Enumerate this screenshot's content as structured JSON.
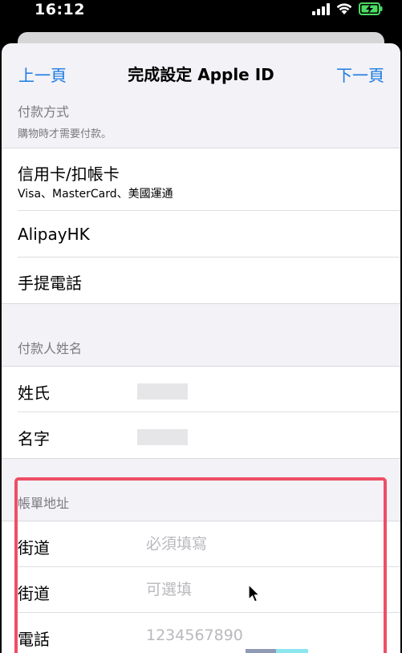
{
  "status_bar": {
    "time": "16:12",
    "icons": [
      "cellular-signal-icon",
      "wifi-icon",
      "battery-charging-icon"
    ],
    "battery_color": "#4cd964"
  },
  "nav": {
    "prev_label": "上一頁",
    "title": "完成設定 Apple ID",
    "next_label": "下一頁"
  },
  "payment": {
    "header": "付款方式",
    "subheader": "購物時才需要付款。",
    "options": [
      {
        "label": "信用卡/扣帳卡",
        "detail": "Visa、MasterCard、美國運通"
      },
      {
        "label": "AlipayHK"
      },
      {
        "label": "手提電話"
      }
    ]
  },
  "payer_name": {
    "header": "付款人姓名",
    "fields": [
      {
        "label": "姓氏"
      },
      {
        "label": "名字"
      }
    ]
  },
  "billing_address": {
    "header": "帳單地址",
    "fields": [
      {
        "label": "街道",
        "placeholder": "必須填寫"
      },
      {
        "label": "街道",
        "placeholder": "可選填"
      },
      {
        "label": "電話",
        "placeholder": "1234567890"
      }
    ]
  },
  "colors": {
    "accent": "#1a7be0",
    "highlight": "#ee4e66",
    "background": "#f2f2f7"
  }
}
